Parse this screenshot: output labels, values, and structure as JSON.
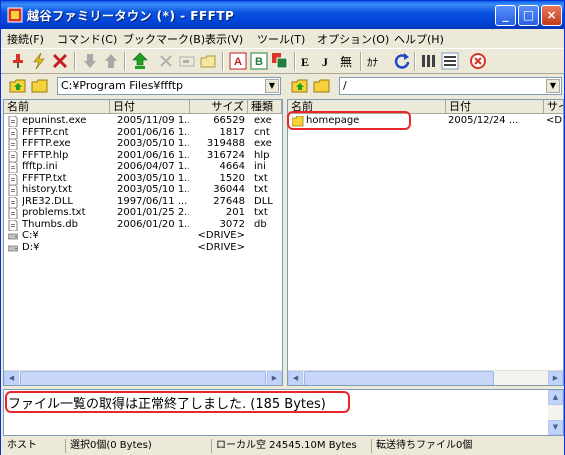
{
  "window": {
    "title": "越谷ファミリータウン (*) - FFFTP",
    "minimize": "_",
    "maximize": "□",
    "close": "×"
  },
  "menu": [
    "接続(F)",
    "コマンド(C)",
    "ブックマーク(B)",
    "表示(V)",
    "ツール(T)",
    "オプション(O)",
    "ヘルプ(H)"
  ],
  "toolbar": {
    "items": [
      "connect-icon",
      "quick-connect-icon",
      "disconnect-icon",
      "download-icon",
      "upload-icon",
      "mirror-upload-icon",
      "delete-icon",
      "rename-icon",
      "mkdir-icon",
      "ascii-mode-icon",
      "binary-mode-icon",
      "auto-mode-icon",
      "euc-icon",
      "jis-icon",
      "no-convert-icon",
      "kana-icon",
      "refresh-icon",
      "list-view-icon",
      "detail-view-icon",
      "stop-icon"
    ],
    "labels": {
      "ascii": "A",
      "binary": "B",
      "euc": "E",
      "jis": "J",
      "none": "無",
      "kana": "ｶﾅ"
    }
  },
  "local": {
    "path": "C:¥Program Files¥ffftp",
    "columns": [
      "名前",
      "日付",
      "サイズ",
      "種類"
    ],
    "files": [
      {
        "name": "epuninst.exe",
        "date": "2005/11/09 1...",
        "size": "66529",
        "type": "exe"
      },
      {
        "name": "FFFTP.cnt",
        "date": "2001/06/16 1...",
        "size": "1817",
        "type": "cnt"
      },
      {
        "name": "FFFTP.exe",
        "date": "2003/05/10 1...",
        "size": "319488",
        "type": "exe"
      },
      {
        "name": "FFFTP.hlp",
        "date": "2001/06/16 1...",
        "size": "316724",
        "type": "hlp"
      },
      {
        "name": "ffftp.ini",
        "date": "2006/04/07 1...",
        "size": "4664",
        "type": "ini"
      },
      {
        "name": "FFFTP.txt",
        "date": "2003/05/10 1...",
        "size": "1520",
        "type": "txt"
      },
      {
        "name": "history.txt",
        "date": "2003/05/10 1...",
        "size": "36044",
        "type": "txt"
      },
      {
        "name": "JRE32.DLL",
        "date": "1997/06/11 ...",
        "size": "27648",
        "type": "DLL"
      },
      {
        "name": "problems.txt",
        "date": "2001/01/25 2...",
        "size": "201",
        "type": "txt"
      },
      {
        "name": "Thumbs.db",
        "date": "2006/01/20 1...",
        "size": "3072",
        "type": "db"
      },
      {
        "name": "C:¥",
        "date": "",
        "size": "<DRIVE>",
        "type": ""
      },
      {
        "name": "D:¥",
        "date": "",
        "size": "<DRIVE>",
        "type": ""
      }
    ]
  },
  "remote": {
    "path": "/",
    "columns": [
      "名前",
      "日付",
      "サイ"
    ],
    "files": [
      {
        "name": "homepage",
        "date": "2005/12/24 ...",
        "size": "<DI"
      }
    ]
  },
  "log": {
    "text": "ファイル一覧の取得は正常終了しました. (185 Bytes)"
  },
  "status": {
    "host": "ホスト",
    "selection": "選択0個(0 Bytes)",
    "local_free": "ローカル空 24545.10M Bytes",
    "queue": "転送待ちファイル0個"
  },
  "colors": {
    "title_bar": "#0a53e0",
    "highlight": "#e8262b",
    "face": "#ece9d8"
  }
}
